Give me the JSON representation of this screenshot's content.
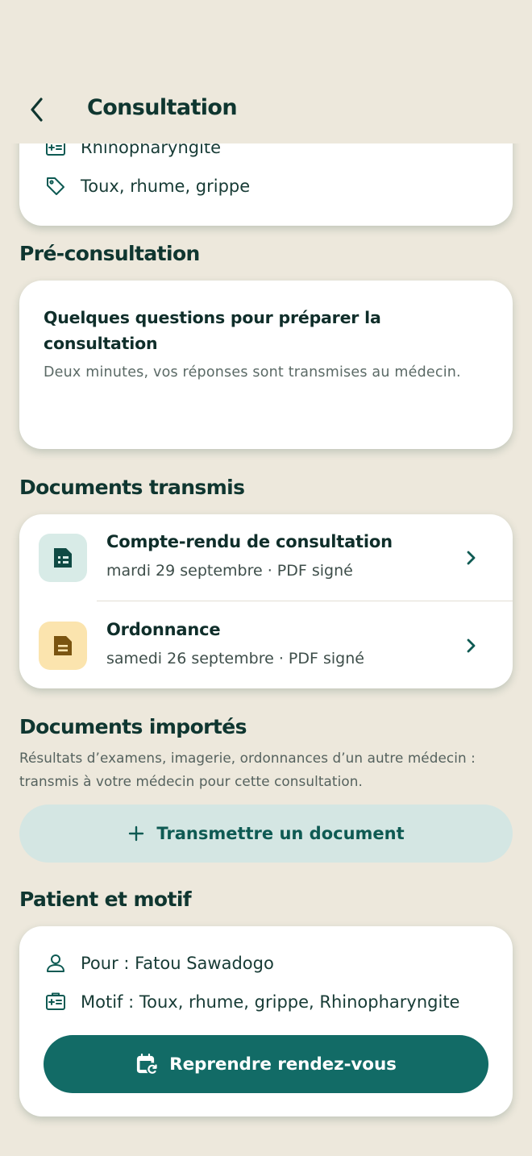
{
  "header": {
    "title": "Consultation",
    "back_icon": "chevron-left-icon"
  },
  "summary": {
    "diagnosis": "Rhinopharyngite",
    "tags": "Toux, rhume, grippe"
  },
  "pre_consultation": {
    "section_title": "Pré-consultation",
    "card_title": "Quelques questions pour préparer la consultation",
    "card_subtitle": "Deux minutes, vos réponses sont transmises au médecin."
  },
  "documents_transmis": {
    "section_title": "Documents transmis",
    "items": [
      {
        "title": "Compte-rendu de consultation",
        "meta": "mardi 29 septembre · PDF signé",
        "icon": "file-report-icon",
        "color": "#D8EBE7"
      },
      {
        "title": "Ordonnance",
        "meta": "samedi 26 septembre · PDF signé",
        "icon": "file-text-icon",
        "color": "#FBE4AE"
      }
    ]
  },
  "documents_importes": {
    "section_title": "Documents importés",
    "subtitle": "Résultats d’examens, imagerie, ordonnances d’un autre médecin : transmis à votre médecin pour cette consultation.",
    "button_label": "Transmettre un document"
  },
  "patient": {
    "section_title": "Patient et motif",
    "for_label": "Pour : Fatou Sawadogo",
    "reason_label": "Motif : Toux, rhume, grippe, Rhinopharyngite",
    "button_label": "Reprendre rendez-vous"
  },
  "colors": {
    "background": "#EDE8DC",
    "primary": "#126B66",
    "primary_light": "#D4E6E3",
    "text_dark": "#0F3630"
  }
}
